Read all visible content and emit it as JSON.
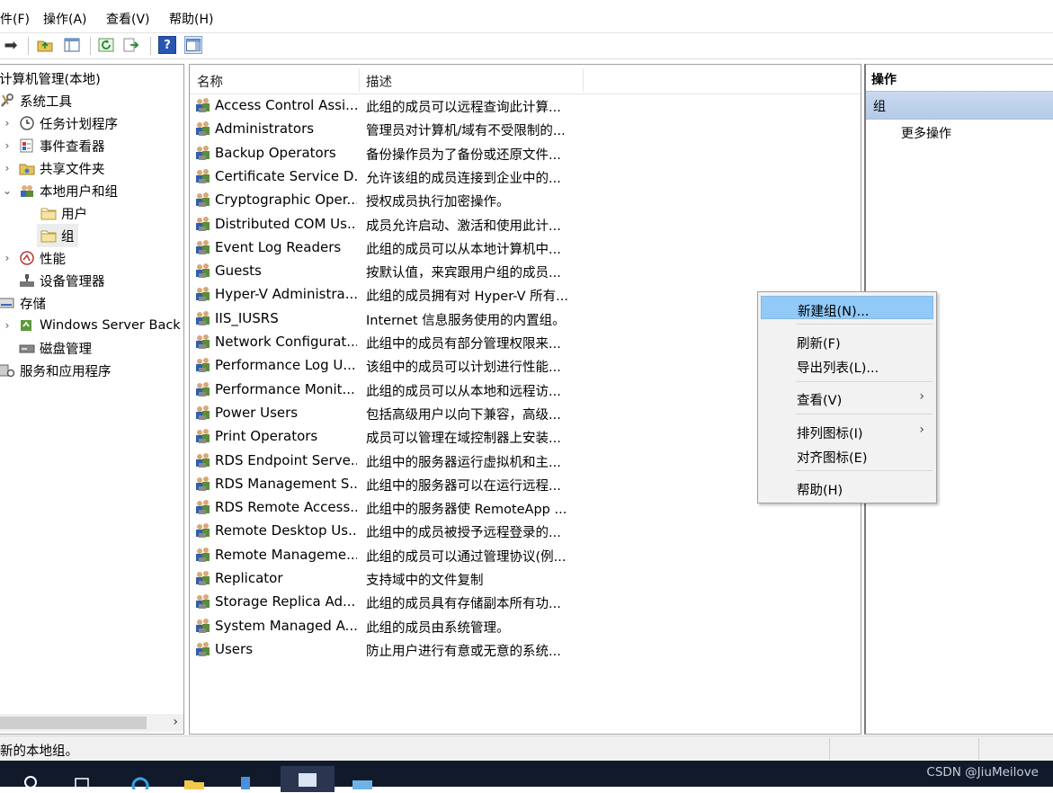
{
  "menu": [
    "件(F)",
    "操作(A)",
    "查看(V)",
    "帮助(H)"
  ],
  "toolbar": {
    "back_glyph": "➡",
    "help_glyph": "?"
  },
  "tree": {
    "items": [
      {
        "label": "计算机管理(本地)",
        "icon": "computer-management-icon",
        "arrow": ""
      },
      {
        "label": "系统工具",
        "icon": "system-tools-icon",
        "arrow": ""
      },
      {
        "label": "任务计划程序",
        "icon": "clock-icon",
        "arrow": "›"
      },
      {
        "label": "事件查看器",
        "icon": "event-viewer-icon",
        "arrow": "›"
      },
      {
        "label": "共享文件夹",
        "icon": "shared-folder-icon",
        "arrow": "›"
      },
      {
        "label": "本地用户和组",
        "icon": "users-icon",
        "arrow": "⌄"
      },
      {
        "label": "用户",
        "icon": "folder-icon",
        "arrow": ""
      },
      {
        "label": "组",
        "icon": "folder-icon",
        "arrow": ""
      },
      {
        "label": "性能",
        "icon": "performance-icon",
        "arrow": "›"
      },
      {
        "label": "设备管理器",
        "icon": "device-manager-icon",
        "arrow": ""
      },
      {
        "label": "存储",
        "icon": "storage-icon",
        "arrow": ""
      },
      {
        "label": "Windows Server Back",
        "icon": "backup-icon",
        "arrow": "›"
      },
      {
        "label": "磁盘管理",
        "icon": "disk-icon",
        "arrow": ""
      },
      {
        "label": "服务和应用程序",
        "icon": "services-icon",
        "arrow": ""
      }
    ],
    "scroll_arrow": "›"
  },
  "list": {
    "headers": {
      "name": "名称",
      "desc": "描述"
    },
    "rows": [
      {
        "name": "Access Control Assi...",
        "desc": "此组的成员可以远程查询此计算..."
      },
      {
        "name": "Administrators",
        "desc": "管理员对计算机/域有不受限制的..."
      },
      {
        "name": "Backup Operators",
        "desc": "备份操作员为了备份或还原文件..."
      },
      {
        "name": "Certificate Service D...",
        "desc": "允许该组的成员连接到企业中的..."
      },
      {
        "name": "Cryptographic Oper...",
        "desc": "授权成员执行加密操作。"
      },
      {
        "name": "Distributed COM Us...",
        "desc": "成员允许启动、激活和使用此计..."
      },
      {
        "name": "Event Log Readers",
        "desc": "此组的成员可以从本地计算机中..."
      },
      {
        "name": "Guests",
        "desc": "按默认值，来宾跟用户组的成员..."
      },
      {
        "name": "Hyper-V Administra...",
        "desc": "此组的成员拥有对 Hyper-V 所有..."
      },
      {
        "name": "IIS_IUSRS",
        "desc": "Internet 信息服务使用的内置组。"
      },
      {
        "name": "Network Configurat...",
        "desc": "此组中的成员有部分管理权限来..."
      },
      {
        "name": "Performance Log U...",
        "desc": "该组中的成员可以计划进行性能..."
      },
      {
        "name": "Performance Monit...",
        "desc": "此组的成员可以从本地和远程访..."
      },
      {
        "name": "Power Users",
        "desc": "包括高级用户以向下兼容，高级..."
      },
      {
        "name": "Print Operators",
        "desc": "成员可以管理在域控制器上安装..."
      },
      {
        "name": "RDS Endpoint Serve...",
        "desc": "此组中的服务器运行虚拟机和主..."
      },
      {
        "name": "RDS Management S...",
        "desc": "此组中的服务器可以在运行远程..."
      },
      {
        "name": "RDS Remote Access...",
        "desc": "此组中的服务器使 RemoteApp ..."
      },
      {
        "name": "Remote Desktop Us...",
        "desc": "此组中的成员被授予远程登录的..."
      },
      {
        "name": "Remote Manageme...",
        "desc": "此组的成员可以通过管理协议(例..."
      },
      {
        "name": "Replicator",
        "desc": "支持域中的文件复制"
      },
      {
        "name": "Storage Replica Ad...",
        "desc": "此组的成员具有存储副本所有功..."
      },
      {
        "name": "System Managed A...",
        "desc": "此组的成员由系统管理。"
      },
      {
        "name": "Users",
        "desc": "防止用户进行有意或无意的系统..."
      }
    ]
  },
  "actions": {
    "title": "操作",
    "group": "组",
    "more": "更多操作"
  },
  "context_menu": {
    "items": [
      {
        "label": "新建组(N)...",
        "sub": ""
      },
      {
        "label": "刷新(F)",
        "sub": ""
      },
      {
        "label": "导出列表(L)...",
        "sub": ""
      },
      {
        "label": "查看(V)",
        "sub": "›"
      },
      {
        "label": "排列图标(I)",
        "sub": "›"
      },
      {
        "label": "对齐图标(E)",
        "sub": ""
      },
      {
        "label": "帮助(H)",
        "sub": ""
      }
    ]
  },
  "status": {
    "text": "新的本地组。"
  },
  "taskbar": {
    "watermark": "CSDN @JiuMeilove"
  },
  "colors": {
    "highlight": "#91c9f7",
    "action_group": "#b5cae8",
    "taskbar": "#101a2b"
  }
}
